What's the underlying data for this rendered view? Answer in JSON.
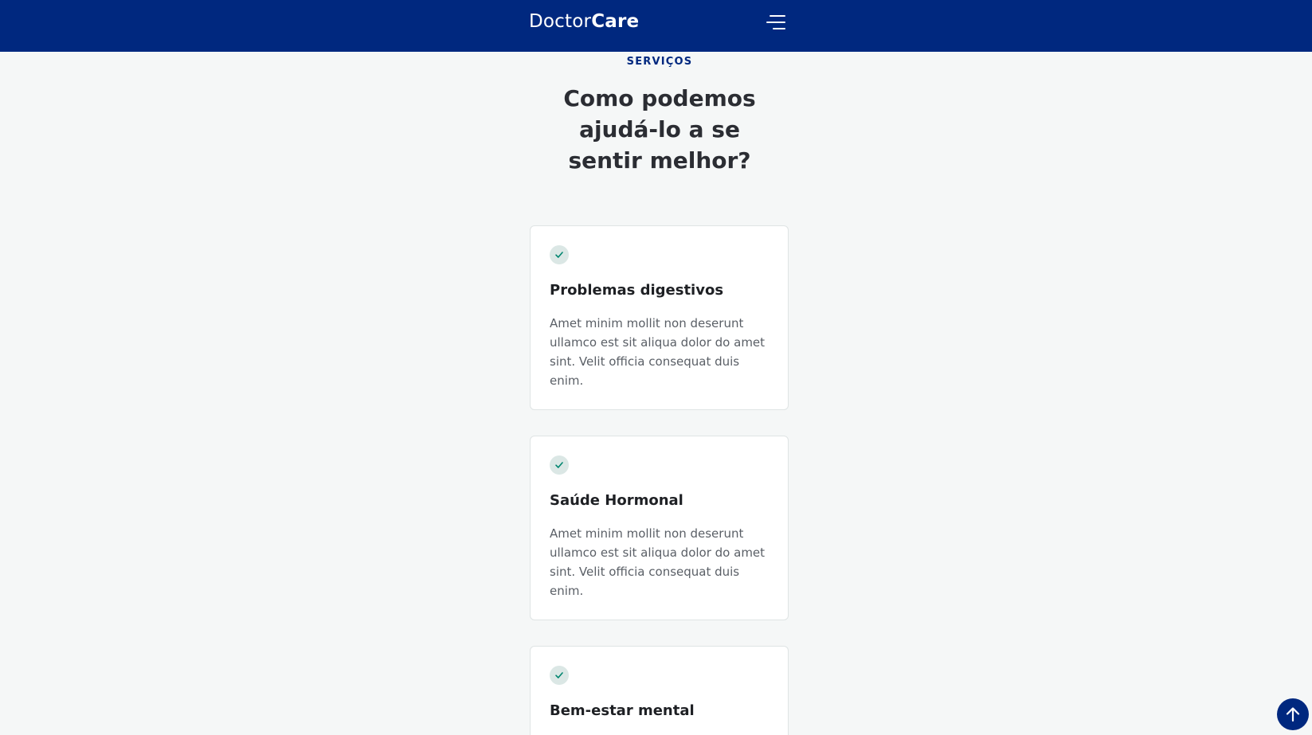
{
  "header": {
    "logo_light": "Doctor",
    "logo_bold": "Care",
    "menu_icon": "hamburger-menu-icon",
    "background": "#00287f"
  },
  "services": {
    "kicker": "SERVIÇOS",
    "title": "Como podemos ajudá-lo a se sentir melhor?",
    "cards": [
      {
        "icon": "check-icon",
        "title": "Problemas digestivos",
        "text": "Amet minim mollit non deserunt ullamco est sit aliqua dolor do amet sint. Velit officia consequat duis enim."
      },
      {
        "icon": "check-icon",
        "title": "Saúde Hormonal",
        "text": "Amet minim mollit non deserunt ullamco est sit aliqua dolor do amet sint. Velit officia consequat duis enim."
      },
      {
        "icon": "check-icon",
        "title": "Bem-estar mental",
        "text": ""
      }
    ]
  },
  "back_to_top": {
    "icon": "arrow-up-icon"
  },
  "colors": {
    "brand": "#00287f",
    "page_background": "#f5f7f7",
    "check_badge": "#dbe7e5",
    "check_mark": "#00856f"
  }
}
